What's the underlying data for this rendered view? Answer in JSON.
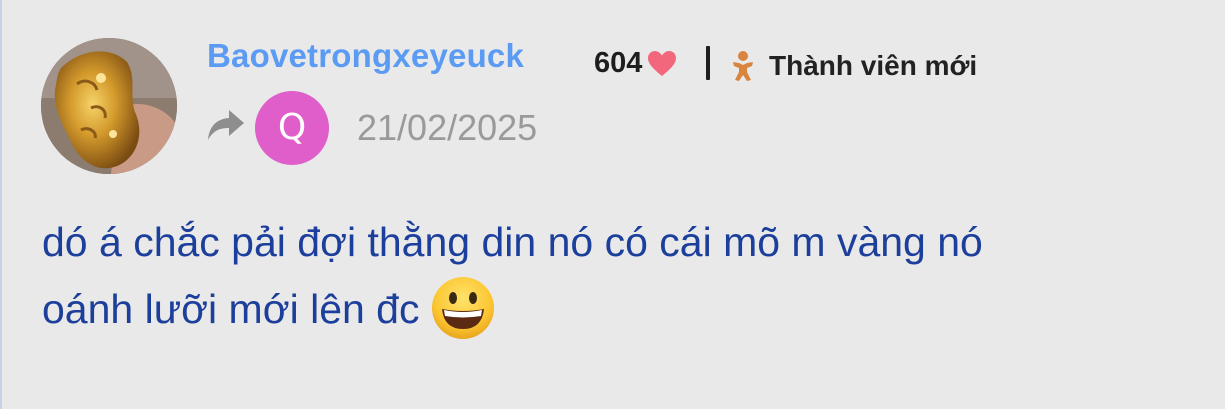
{
  "post": {
    "author": {
      "username": "Baovetrongxeyeuck",
      "likes": "604",
      "rank": "Thành viên mới"
    },
    "reply_to": {
      "initial": "Q"
    },
    "date": "21/02/2025",
    "body_line1": "dó á chắc pải đợi thằng din nó có cái mõ m vàng nó",
    "body_line2": "oánh lưỡi mới lên đc",
    "emoji": "grinning-face"
  },
  "colors": {
    "background": "#e9e9e9",
    "username": "#5b9bf3",
    "heart": "#f2677c",
    "rank_icon": "#d9853f",
    "quote_avatar": "#e05ec9",
    "date": "#9a9a9a",
    "body_text": "#1d3f9c"
  }
}
